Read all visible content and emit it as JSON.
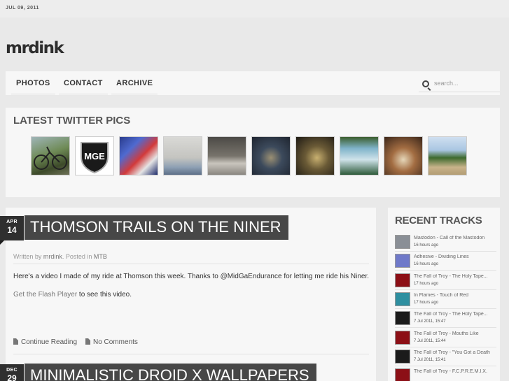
{
  "header": {
    "date": "JUL 09, 2011",
    "logo": "mrdink"
  },
  "nav": {
    "items": [
      {
        "label": "PHOTOS"
      },
      {
        "label": "CONTACT"
      },
      {
        "label": "ARCHIVE"
      }
    ],
    "search_placeholder": "search..."
  },
  "twitter": {
    "title": "LATEST TWITTER PICS",
    "pics": [
      {
        "desc": "bike"
      },
      {
        "desc": "MGE shield logo",
        "logo_text": "MGE"
      },
      {
        "desc": "snacks"
      },
      {
        "desc": "room"
      },
      {
        "desc": "can on table"
      },
      {
        "desc": "drum kit"
      },
      {
        "desc": "drum kit"
      },
      {
        "desc": "Hell or High Watermelon can"
      },
      {
        "desc": "drum kit"
      },
      {
        "desc": "dirt road"
      }
    ]
  },
  "posts": [
    {
      "month": "APR",
      "day": "14",
      "title": "THOMSON TRAILS ON THE NINER",
      "meta_prefix": "Written by ",
      "author": "mrdink",
      "meta_middle": ". Posted in ",
      "category": "MTB",
      "body": "Here's a video I made of my ride at Thomson this week. Thanks to @MidGaEndurance for letting me ride his Niner.",
      "flash_link": "Get the Flash Player",
      "flash_suffix": " to see this video.",
      "continue_label": "Continue Reading",
      "comments_label": "No Comments"
    },
    {
      "month": "DEC",
      "day": "29",
      "title": "MINIMALISTIC DROID X WALLPAPERS"
    }
  ],
  "recent_tracks": {
    "title": "RECENT TRACKS",
    "tracks": [
      {
        "name": "Mastodon - Call of the Mastodon",
        "time": "16 hours ago",
        "art_color": "#8a8f96"
      },
      {
        "name": "Adhesive - Dividing Lines",
        "time": "16 hours ago",
        "art_color": "#6f79c9"
      },
      {
        "name": "The Fall of Troy - The Holy Tape...",
        "time": "17 hours ago",
        "art_color": "#8c0f16"
      },
      {
        "name": "In Flames - Touch of Red",
        "time": "17 hours ago",
        "art_color": "#2e8fa0"
      },
      {
        "name": "The Fall of Troy - The Holy Tape...",
        "time": "7 Jul 2011, 15:47",
        "art_color": "#1b1b1b"
      },
      {
        "name": "The Fall of Troy - Mouths Like",
        "time": "7 Jul 2011, 15:44",
        "art_color": "#8c0f16"
      },
      {
        "name": "The Fall of Troy - \"You Got a Death",
        "time": "7 Jul 2011, 15:41",
        "art_color": "#1b1b1b"
      },
      {
        "name": "The Fall of Troy - F.C.P.R.E.M.I.X.",
        "time": "",
        "art_color": "#8c0f16"
      }
    ]
  },
  "colors": {
    "title_bar": "#474747",
    "date_tag": "#2f2f2f",
    "page_bg": "#e9e9e9",
    "panel_bg": "#f7f7f7"
  }
}
